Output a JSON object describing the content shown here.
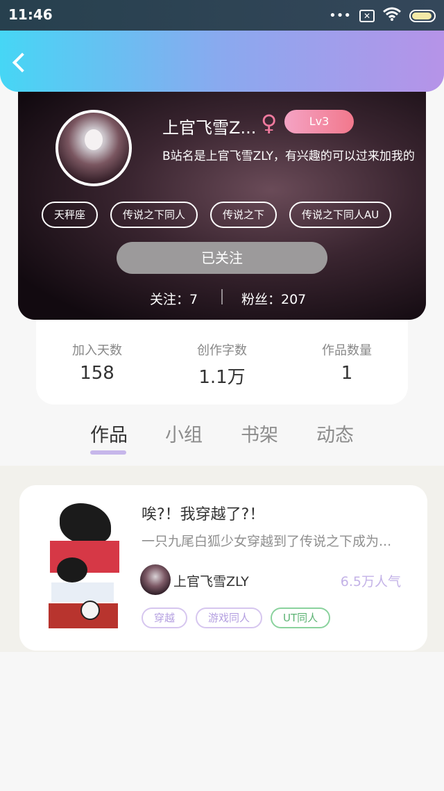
{
  "status": {
    "time": "11:46"
  },
  "profile": {
    "name": "上官飞雪Z...",
    "gender_symbol": "♀",
    "level": "Lv3",
    "bio": "B站名是上官飞雪ZLY，有兴趣的可以过来加我的",
    "tags": [
      "天秤座",
      "传说之下同人",
      "传说之下",
      "传说之下同人AU"
    ],
    "follow_button": "已关注",
    "following_label": "关注：7",
    "fans_label": "粉丝：207"
  },
  "stats": [
    {
      "label": "加入天数",
      "value": "158"
    },
    {
      "label": "创作字数",
      "value": "1.1万"
    },
    {
      "label": "作品数量",
      "value": "1"
    }
  ],
  "tabs": [
    "作品",
    "小组",
    "书架",
    "动态"
  ],
  "works": [
    {
      "title": "唉?！我穿越了?！",
      "description": "一只九尾白狐少女穿越到了传说之下成为...",
      "author": "上官飞雪ZLY",
      "popularity": "6.5万人气",
      "tags": [
        "穿越",
        "游戏同人",
        "UT同人"
      ]
    }
  ]
}
